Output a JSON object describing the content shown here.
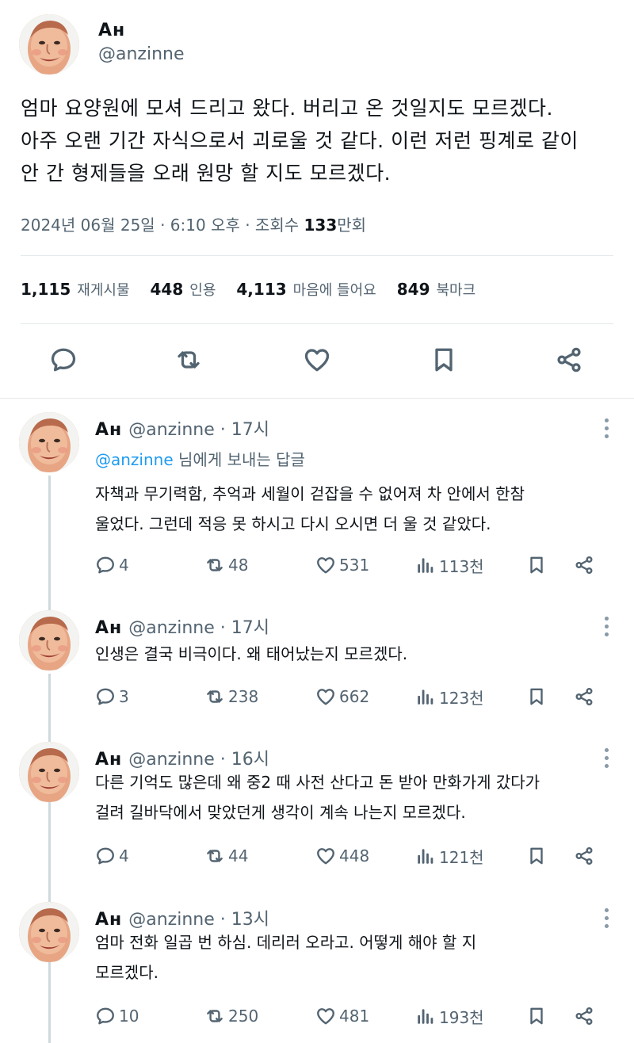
{
  "main": {
    "name": "Aн",
    "handle": "@anzinne",
    "text": [
      "엄마 요양원에 모셔 드리고 왔다. 버리고 온 것일지도 모르겠다.",
      "아주 오랜 기간 자식으로서 괴로울 것 같다. 이런 저런 핑계로 같이",
      "안 간 형제들을 오래 원망 할 지도 모르겠다."
    ],
    "date": "2024년 06월 25일 · 6:10 오후 · 조회수 ",
    "views_num": "133",
    "views_suffix": "만회",
    "stats": {
      "reposts": "1,115",
      "reposts_label": "재게시물",
      "quotes": "448",
      "quotes_label": "인용",
      "likes": "4,113",
      "likes_label": "마음에 들어요",
      "bookmarks": "849",
      "bookmarks_label": "북마크"
    },
    "icons": [
      "reply-icon",
      "repost-icon",
      "like-icon",
      "bookmark-icon",
      "share-icon"
    ]
  },
  "replies": [
    {
      "name": "Aн",
      "handle": "@anzinne",
      "time": "· 17시",
      "reply_to_handle": "@anzinne",
      "reply_to_suffix": " 님에게 보내는 답글",
      "text": [
        "자책과 무기력함, 추억과 세월이 걷잡을 수 없어져 차 안에서 한참",
        "울었다. 그런데 적응 못 하시고 다시 오시면 더 울 것 같았다."
      ],
      "replies": "4",
      "reposts": "48",
      "likes": "531",
      "views": "113천"
    },
    {
      "name": "Aн",
      "handle": "@anzinne",
      "time": "· 17시",
      "text": [
        "인생은 결국 비극이다. 왜 태어났는지 모르겠다."
      ],
      "replies": "3",
      "reposts": "238",
      "likes": "662",
      "views": "123천"
    },
    {
      "name": "Aн",
      "handle": "@anzinne",
      "time": "· 16시",
      "text": [
        "다른 기억도 많은데 왜 중2 때 사전 산다고 돈 받아 만화가게 갔다가",
        "걸려 길바닥에서 맞았던게 생각이 계속 나는지 모르겠다."
      ],
      "replies": "4",
      "reposts": "44",
      "likes": "448",
      "views": "121천"
    },
    {
      "name": "Aн",
      "handle": "@anzinne",
      "time": "· 13시",
      "text": [
        "엄마 전화 일곱 번 하심. 데리러 오라고. 어떻게 해야 할 지",
        "모르겠다."
      ],
      "replies": "10",
      "reposts": "250",
      "likes": "481",
      "views": "193천"
    }
  ],
  "colors": {
    "text": "#0f1419",
    "muted": "#536471",
    "link": "#1d9bf0",
    "divider": "#e6e9eb"
  }
}
